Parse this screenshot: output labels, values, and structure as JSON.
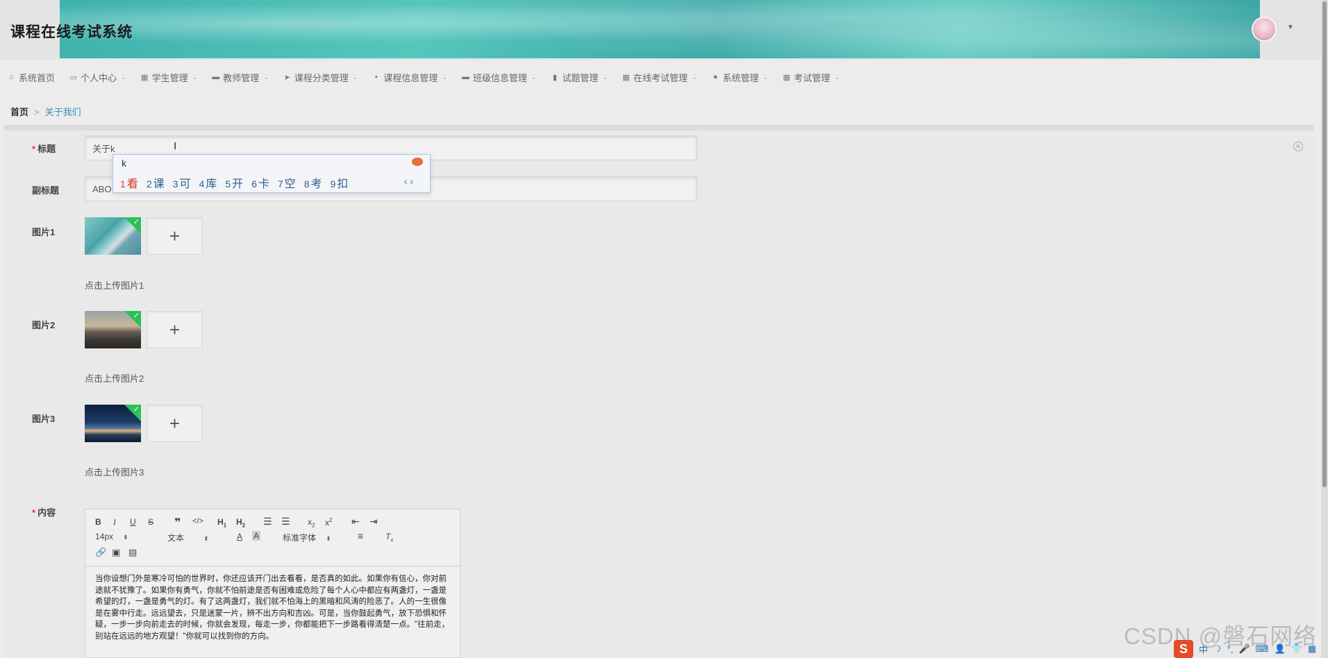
{
  "app": {
    "title": "课程在线考试系统"
  },
  "nav": [
    {
      "label": "系统首页",
      "icon": "home-icon",
      "glyph": "⌂",
      "caret": false
    },
    {
      "label": "个人中心",
      "icon": "calendar-icon",
      "glyph": "▭",
      "caret": true
    },
    {
      "label": "学生管理",
      "icon": "grid-icon",
      "glyph": "▦",
      "caret": true
    },
    {
      "label": "教师管理",
      "icon": "monitor-icon",
      "glyph": "▬",
      "caret": true
    },
    {
      "label": "课程分类管理",
      "icon": "send-icon",
      "glyph": "➤",
      "caret": true
    },
    {
      "label": "课程信息管理",
      "icon": "chat-icon",
      "glyph": "▪",
      "caret": true
    },
    {
      "label": "班级信息管理",
      "icon": "printer-icon",
      "glyph": "▬",
      "caret": true
    },
    {
      "label": "试题管理",
      "icon": "bar-chart-icon",
      "glyph": "▮",
      "caret": true
    },
    {
      "label": "在线考试管理",
      "icon": "grid-icon",
      "glyph": "▦",
      "caret": true
    },
    {
      "label": "系统管理",
      "icon": "user-icon",
      "glyph": "●",
      "caret": true
    },
    {
      "label": "考试管理",
      "icon": "grid-icon",
      "glyph": "▦",
      "caret": true
    }
  ],
  "breadcrumb": {
    "home": "首页",
    "sep": ">",
    "current": "关于我们"
  },
  "form": {
    "title_label": "标题",
    "title_value": "关于k",
    "subtitle_label": "副标题",
    "subtitle_value": "ABO",
    "image1_label": "图片1",
    "image1_hint": "点击上传图片1",
    "image2_label": "图片2",
    "image2_hint": "点击上传图片2",
    "image3_label": "图片3",
    "image3_hint": "点击上传图片3",
    "content_label": "内容",
    "required_mark": "*",
    "plus": "+",
    "check": "✓"
  },
  "ime": {
    "input": "k",
    "candidates": [
      {
        "n": "1",
        "c": "看"
      },
      {
        "n": "2",
        "c": "课"
      },
      {
        "n": "3",
        "c": "可"
      },
      {
        "n": "4",
        "c": "库"
      },
      {
        "n": "5",
        "c": "开"
      },
      {
        "n": "6",
        "c": "卡"
      },
      {
        "n": "7",
        "c": "空"
      },
      {
        "n": "8",
        "c": "考"
      },
      {
        "n": "9",
        "c": "扣"
      }
    ],
    "arrows": "‹ ›"
  },
  "editor": {
    "font_size": "14px",
    "block_type": "文本",
    "font_family": "标准字体",
    "content": "当你设想门外是寒冷可怕的世界时，你还应该开门出去看看，是否真的如此。如果你有信心，你对前途就不犹豫了。如果你有勇气，你就不怕前途是否有困难或危险了每个人心中都应有两盏灯，一盏是希望的灯，一盏是勇气的灯。有了这两盏灯，我们就不怕海上的黑暗和风涛的险恶了。人的一生很像是在雾中行走。远远望去，只是迷蒙一片，辨不出方向和吉凶。可是，当你鼓起勇气，放下恐惧和怀疑，一步一步向前走去的时候，你就会发现，每走一步，你都能把下一步路看得清楚一点。\"往前走，别站在远远的地方观望！\"你就可以找到你的方向。"
  },
  "watermark": "CSDN @磐石网络",
  "tray": {
    "s": "S",
    "lang": "中",
    "moon": "☽",
    "punct": "°,"
  }
}
